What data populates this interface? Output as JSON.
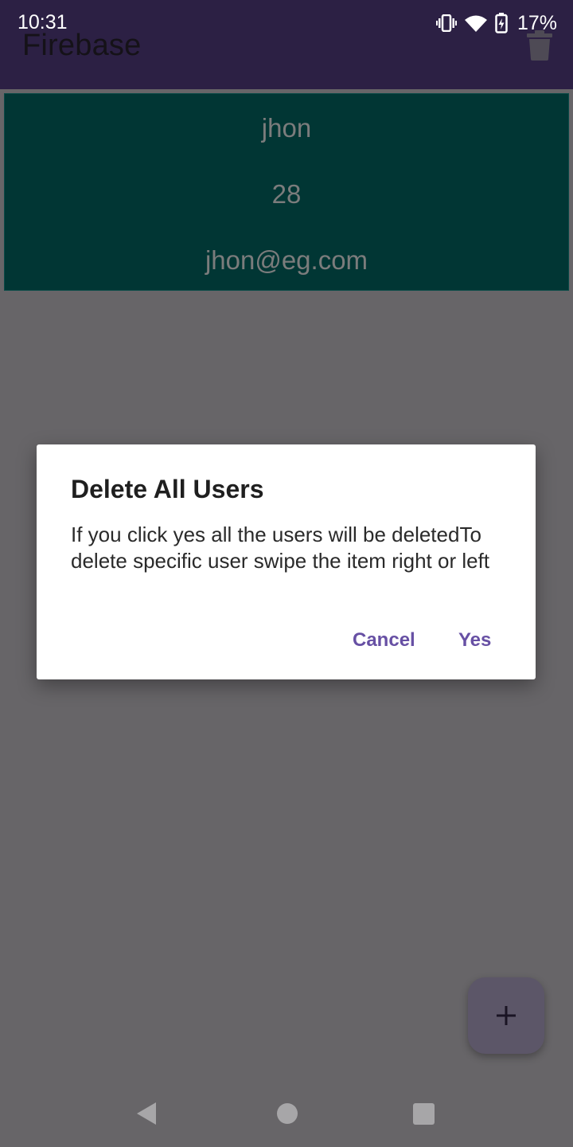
{
  "status_bar": {
    "time": "10:31",
    "battery_percent": "17%",
    "icons": [
      "vibrate-icon",
      "wifi-icon",
      "battery-charging-icon"
    ]
  },
  "app_bar": {
    "title": "Firebase",
    "action_icon": "trash-icon"
  },
  "user_card": {
    "name": "jhon",
    "age": "28",
    "email": "jhon@eg.com"
  },
  "dialog": {
    "title": "Delete All Users",
    "message": "If you click yes all the users will be deletedTo delete specific user swipe the item right or left",
    "cancel_label": "Cancel",
    "confirm_label": "Yes"
  },
  "fab": {
    "icon": "plus-icon"
  },
  "nav_bar": {
    "icons": [
      "back-icon",
      "home-icon",
      "recents-icon"
    ]
  },
  "colors": {
    "scrim": "#676568",
    "app_bar": "#2c2044",
    "card": "#013634",
    "dialog_button": "#6750a4"
  }
}
